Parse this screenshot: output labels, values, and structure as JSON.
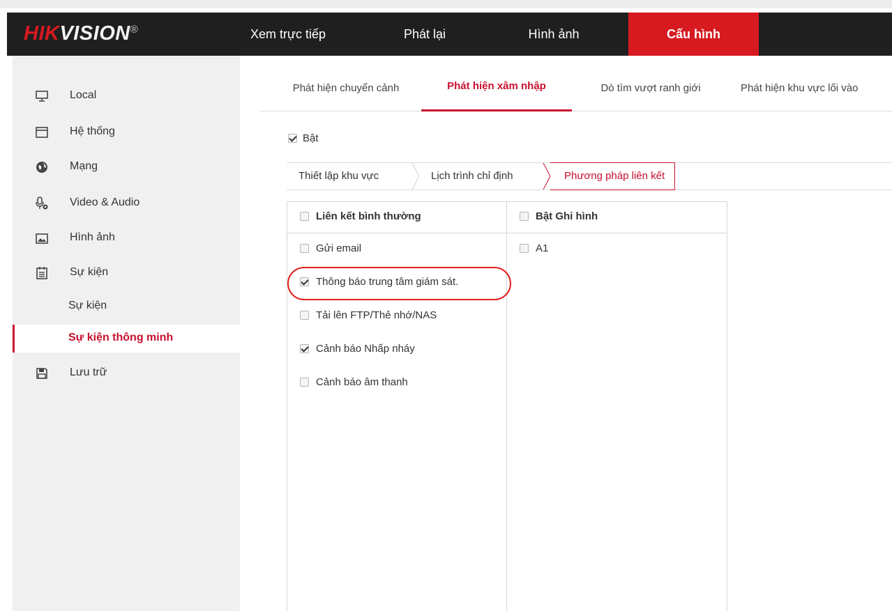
{
  "header": {
    "logo_hik": "HIK",
    "logo_vision": "VISION",
    "logo_reg": "®",
    "nav": [
      {
        "label": "Xem trực tiếp",
        "active": false
      },
      {
        "label": "Phát lại",
        "active": false
      },
      {
        "label": "Hình ảnh",
        "active": false
      },
      {
        "label": "Cấu hình",
        "active": true
      }
    ]
  },
  "sidebar": {
    "items": [
      {
        "label": "Local",
        "icon": "monitor-icon"
      },
      {
        "label": "Hệ thống",
        "icon": "window-icon"
      },
      {
        "label": "Mạng",
        "icon": "globe-icon"
      },
      {
        "label": "Video & Audio",
        "icon": "mic-gear-icon"
      },
      {
        "label": "Hình ảnh",
        "icon": "image-icon"
      },
      {
        "label": "Sự kiện",
        "icon": "calendar-icon"
      },
      {
        "label": "Lưu trữ",
        "icon": "floppy-icon"
      }
    ],
    "sub_items": [
      {
        "label": "Sự kiện",
        "active": false
      },
      {
        "label": "Sự kiện thông minh",
        "active": true
      }
    ]
  },
  "tabs": [
    {
      "label": "Phát hiện chuyển cảnh",
      "active": false
    },
    {
      "label": "Phát hiện xâm nhập",
      "active": true
    },
    {
      "label": "Dò tìm vượt ranh giới",
      "active": false
    },
    {
      "label": "Phát hiện khu vực lối vào",
      "active": false
    }
  ],
  "enable": {
    "label": "Bật",
    "checked": true
  },
  "subtabs": [
    {
      "label": "Thiết lập khu vực",
      "active": false
    },
    {
      "label": "Lịch trình chỉ định",
      "active": false
    },
    {
      "label": "Phương pháp liên kết",
      "active": true
    }
  ],
  "link_table": {
    "normal": {
      "header": "Liên kết bình thường",
      "header_checked": false,
      "rows": [
        {
          "label": "Gửi email",
          "checked": false
        },
        {
          "label": "Thông báo trung tâm giám sát.",
          "checked": true
        },
        {
          "label": "Tải lên FTP/Thẻ nhớ/NAS",
          "checked": false
        },
        {
          "label": "Cảnh báo Nhấp nháy",
          "checked": true
        },
        {
          "label": "Cảnh báo âm thanh",
          "checked": false
        }
      ]
    },
    "record": {
      "header": "Bật Ghi hình",
      "header_checked": false,
      "rows": [
        {
          "label": "A1",
          "checked": false
        }
      ]
    }
  },
  "colors": {
    "accent": "#c8102e",
    "nav_active": "#d71920",
    "header_bg": "#1f1f1f",
    "sidebar_bg": "#f0f0f0",
    "highlight_ring": "#e0201f"
  }
}
